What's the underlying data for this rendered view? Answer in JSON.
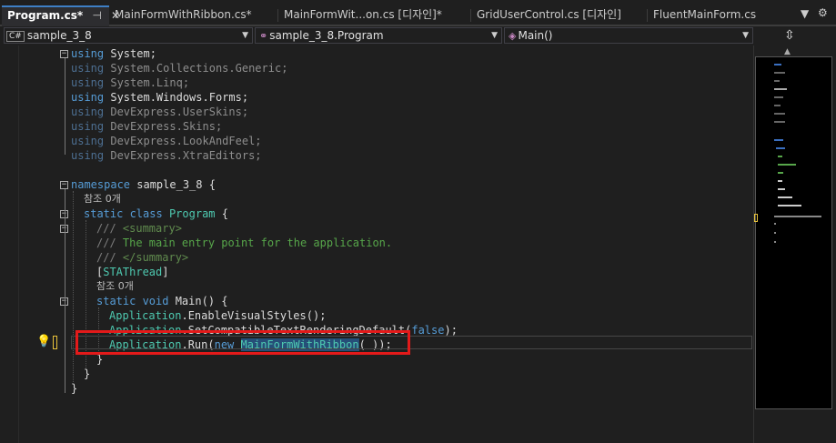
{
  "tabs": [
    {
      "label": "Program.cs*",
      "active": true
    },
    {
      "label": "MainFormWithRibbon.cs*"
    },
    {
      "label": "MainFormWit...on.cs [디자인]*"
    },
    {
      "label": "GridUserControl.cs [디자인]"
    },
    {
      "label": "FluentMainForm.cs"
    }
  ],
  "tab_icons": {
    "pin": "pin-icon",
    "close": "close-icon",
    "dropdown": "dropdown-icon",
    "settings": "gear-icon"
  },
  "nav": {
    "project": "sample_3_8",
    "project_icon": "C#",
    "class": "sample_3_8.Program",
    "member": "Main()"
  },
  "code": {
    "l1": {
      "kw": "using",
      "rest": " System;"
    },
    "l2": {
      "kw": "using",
      "rest": " System.Collections.Generic;"
    },
    "l3": {
      "kw": "using",
      "rest": " System.Linq;"
    },
    "l4": {
      "kw": "using",
      "rest": " System.Windows.Forms;"
    },
    "l5": {
      "kw": "using",
      "rest": " DevExpress.UserSkins;"
    },
    "l6": {
      "kw": "using",
      "rest": " DevExpress.Skins;"
    },
    "l7": {
      "kw": "using",
      "rest": " DevExpress.LookAndFeel;"
    },
    "l8": {
      "kw": "using",
      "rest": " DevExpress.XtraEditors;"
    },
    "l9": {
      "kw": "namespace",
      "rest": " sample_3_8 {"
    },
    "l10": {
      "ref": "참조 0개"
    },
    "l11": {
      "kw1": "static",
      "kw2": " class",
      "cls": " Program",
      "rest": " {"
    },
    "l12": {
      "doc1": "/// ",
      "doc2": "<summary>"
    },
    "l13": {
      "doc1": "/// ",
      "doc2": "The main entry point for the application."
    },
    "l14": {
      "doc1": "/// ",
      "doc2": "</summary>"
    },
    "l15": {
      "b1": "[",
      "attr": "STAThread",
      "b2": "]"
    },
    "l16": {
      "ref": "참조 0개"
    },
    "l17": {
      "kw1": "static",
      "kw2": " void",
      "rest": " Main() {"
    },
    "l18": {
      "cls": "Application",
      "rest": ".EnableVisualStyles();"
    },
    "l19": {
      "cls": "Application",
      "rest": ".SetCompatibleTextRenderingDefault(",
      "kw": "false",
      "end": ");"
    },
    "l20": {
      "cls": "Application",
      "rest": ".Run(",
      "kw": "new",
      "sp": " ",
      "sel": "MainFormWithRibbon",
      "end": "( ));"
    },
    "l21": {
      "rest": "}"
    },
    "l22": {
      "rest": "}"
    },
    "l23": {
      "rest": "}"
    }
  },
  "colors": {
    "keyword": "#569cd6",
    "class": "#4ec9b0",
    "comment": "#57a64a",
    "highlight": "#e31a1a",
    "selection": "#264f78"
  }
}
